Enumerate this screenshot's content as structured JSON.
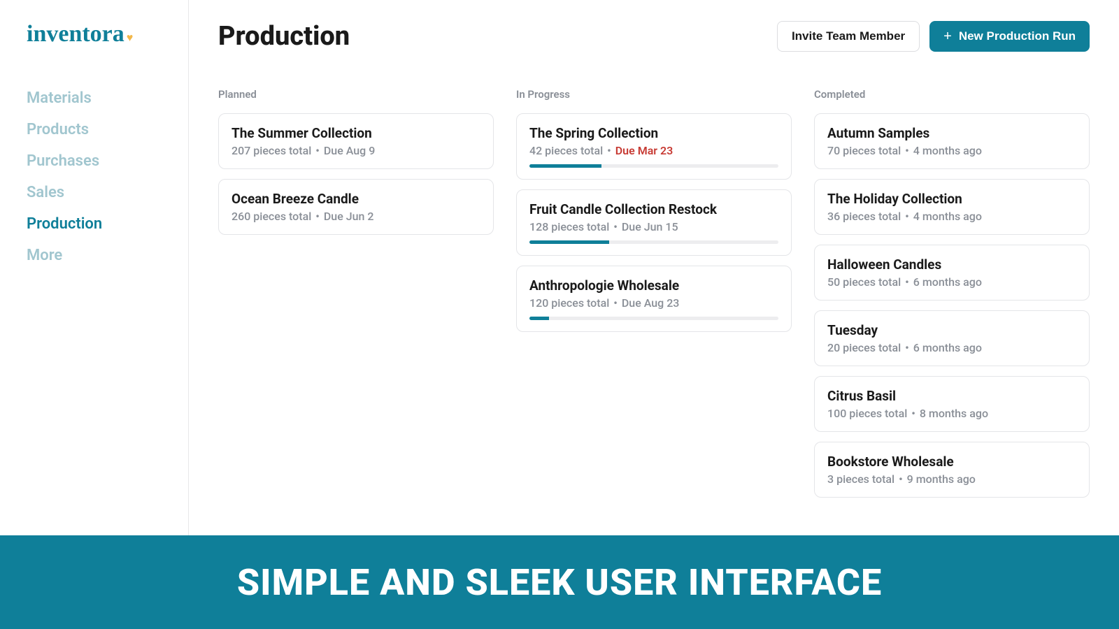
{
  "brand": {
    "name": "inventora"
  },
  "sidebar": {
    "items": [
      {
        "label": "Materials",
        "active": false
      },
      {
        "label": "Products",
        "active": false
      },
      {
        "label": "Purchases",
        "active": false
      },
      {
        "label": "Sales",
        "active": false
      },
      {
        "label": "Production",
        "active": true
      },
      {
        "label": "More",
        "active": false
      }
    ]
  },
  "header": {
    "title": "Production",
    "invite_label": "Invite Team Member",
    "new_run_label": "New Production Run"
  },
  "columns": {
    "planned": {
      "heading": "Planned",
      "cards": [
        {
          "title": "The Summer Collection",
          "pieces": "207 pieces total",
          "due": "Due Aug 9"
        },
        {
          "title": "Ocean Breeze Candle",
          "pieces": "260 pieces total",
          "due": "Due Jun 2"
        }
      ]
    },
    "in_progress": {
      "heading": "In Progress",
      "cards": [
        {
          "title": "The Spring Collection",
          "pieces": "42 pieces total",
          "due": "Due Mar 23",
          "overdue": true,
          "progress": 29
        },
        {
          "title": "Fruit Candle Collection Restock",
          "pieces": "128 pieces total",
          "due": "Due Jun 15",
          "overdue": false,
          "progress": 32
        },
        {
          "title": "Anthropologie Wholesale",
          "pieces": "120 pieces total",
          "due": "Due Aug 23",
          "overdue": false,
          "progress": 8
        }
      ]
    },
    "completed": {
      "heading": "Completed",
      "cards": [
        {
          "title": "Autumn Samples",
          "pieces": "70 pieces total",
          "due": "4 months ago"
        },
        {
          "title": "The Holiday Collection",
          "pieces": "36 pieces total",
          "due": "4 months ago"
        },
        {
          "title": "Halloween Candles",
          "pieces": "50 pieces total",
          "due": "6 months ago"
        },
        {
          "title": "Tuesday",
          "pieces": "20 pieces total",
          "due": "6 months ago"
        },
        {
          "title": "Citrus Basil",
          "pieces": "100 pieces total",
          "due": "8 months ago"
        },
        {
          "title": "Bookstore Wholesale",
          "pieces": "3 pieces total",
          "due": "9 months ago"
        }
      ]
    }
  },
  "banner": {
    "text": "SIMPLE AND SLEEK USER INTERFACE"
  }
}
